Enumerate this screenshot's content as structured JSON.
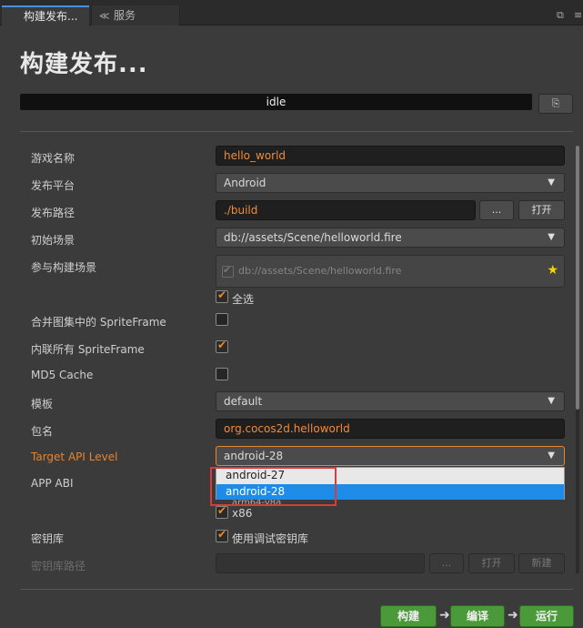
{
  "tabs": [
    {
      "label": "构建发布...",
      "icon": "window-icon"
    },
    {
      "label": "服务",
      "icon": "service-icon"
    }
  ],
  "window_buttons": [
    "⧉",
    "≡"
  ],
  "title": "构建发布...",
  "status": {
    "text": "idle",
    "button_icon": "⎘"
  },
  "form": {
    "game_name": {
      "label": "游戏名称",
      "value": "hello_world"
    },
    "platform": {
      "label": "发布平台",
      "value": "Android"
    },
    "path": {
      "label": "发布路径",
      "value": "./build",
      "browse": "...",
      "open": "打开"
    },
    "start_scene": {
      "label": "初始场景",
      "value": "db://assets/Scene/helloworld.fire"
    },
    "build_scenes": {
      "label": "参与构建场景",
      "scene": "db://assets/Scene/helloworld.fire",
      "select_all": "全选"
    },
    "merge_sprite": {
      "label": "合并图集中的 SpriteFrame",
      "checked": false
    },
    "inline_sprite": {
      "label": "内联所有 SpriteFrame",
      "checked": true
    },
    "md5": {
      "label": "MD5 Cache",
      "checked": false
    },
    "template": {
      "label": "模板",
      "value": "default"
    },
    "package": {
      "label": "包名",
      "value": "org.cocos2d.helloworld"
    },
    "api_level": {
      "label": "Target API Level",
      "value": "android-28",
      "options": [
        "android-27",
        "android-28"
      ],
      "selected": "android-28"
    },
    "app_abi": {
      "label": "APP ABI",
      "hidden_option": "arm64-v8a",
      "x86_label": "x86"
    },
    "keystore": {
      "label": "密钥库",
      "option": "使用调试密钥库"
    },
    "keystore_path": {
      "label": "密钥库路径",
      "browse": "...",
      "open": "打开",
      "new": "新建"
    }
  },
  "actions": {
    "build": "构建",
    "compile": "编译",
    "run": "运行"
  }
}
